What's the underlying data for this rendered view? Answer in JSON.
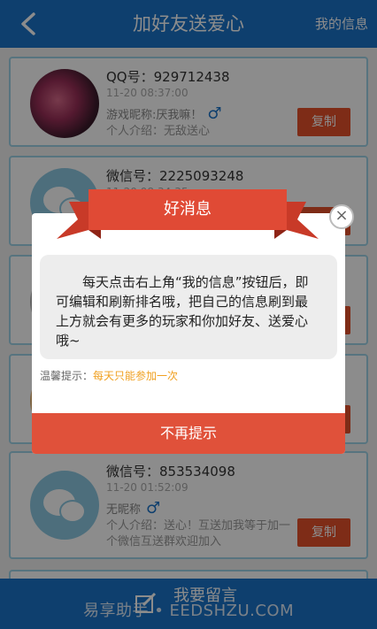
{
  "header": {
    "title": "加好友送爱心",
    "my_info": "我的信息"
  },
  "cards": [
    {
      "id": "QQ号：929712438",
      "time": "11-20 08:37:00",
      "nick": "游戏昵称:厌我嘛！",
      "intro": "个人介绍：无敌送心",
      "copy": "复制"
    },
    {
      "id": "微信号：2225093248",
      "time": "11-20 08:34:35",
      "nick": "",
      "intro": "",
      "copy": "复制"
    },
    {
      "id": "",
      "time": "",
      "nick": "",
      "intro": "",
      "copy": "复制"
    },
    {
      "id": "",
      "time": "",
      "nick": "",
      "intro": "",
      "copy": "复制"
    },
    {
      "id": "微信号：853534098",
      "time": "11-20 01:52:09",
      "nick": "无昵称",
      "intro": "个人介绍：送心！互送加我等于加一个微信互送群欢迎加入",
      "copy": "复制"
    }
  ],
  "bottom": {
    "leave_message": "我要留言"
  },
  "watermark": "易享助手 • EEDSHZU.COM",
  "dialog": {
    "title": "好消息",
    "message": "每天点击右上角“我的信息”按钮后，即可编辑和刷新排名哦，把自己的信息刷到最上方就会有更多的玩家和你加好友、送爱心哦~",
    "tip_label": "温馨提示：",
    "tip_value": "每天只能参加一次",
    "button": "不再提示",
    "close": "×"
  },
  "icons": {
    "back": "chevron-left-icon",
    "male": "male-icon",
    "wechat": "wechat-icon",
    "pencil": "edit-icon",
    "close": "close-icon"
  },
  "colors": {
    "primary": "#1a73c9",
    "accent": "#e5512a",
    "ribbon": "#e04a35",
    "tip": "#f0a020"
  }
}
